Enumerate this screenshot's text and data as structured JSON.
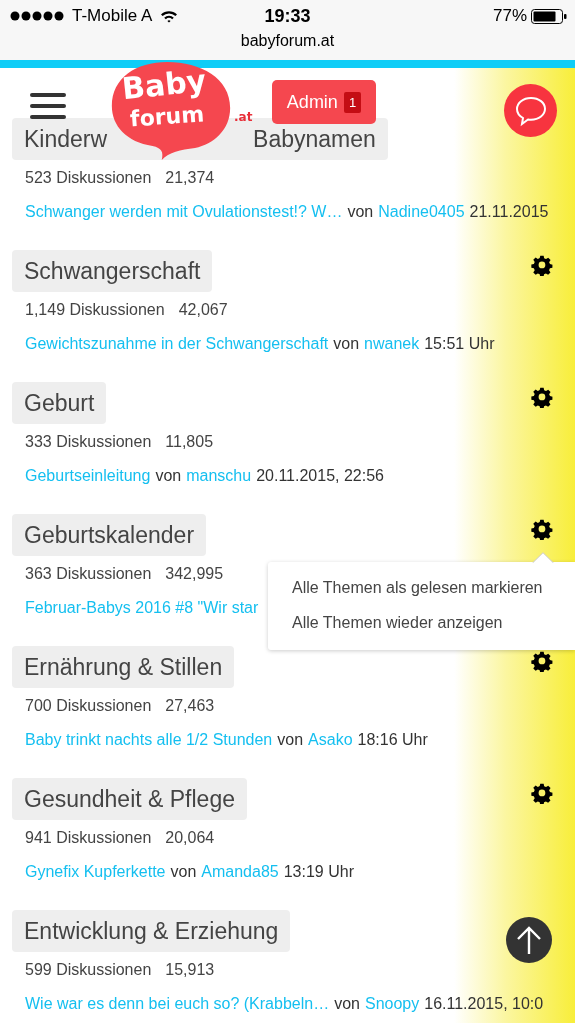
{
  "status_bar": {
    "carrier": "T-Mobile A",
    "time": "19:33",
    "battery": "77%"
  },
  "address_bar": {
    "url": "babyforum.at"
  },
  "header": {
    "logo": {
      "line1": "Baby",
      "line2": "forum",
      "suffix": ".at"
    },
    "admin_button": {
      "label": "Admin",
      "badge": "1"
    }
  },
  "categories": [
    {
      "title_fragments": [
        "Kinderw",
        "Babynamen"
      ],
      "gear_hidden": true,
      "discussions": "523 Diskussionen",
      "count": "21,374",
      "last_post": {
        "topic": "Schwanger werden mit Ovulationstest!? W…",
        "by": "von",
        "author": "Nadine0405",
        "time": "21.11.2015"
      }
    },
    {
      "title": "Schwangerschaft",
      "discussions": "1,149 Diskussionen",
      "count": "42,067",
      "last_post": {
        "topic": "Gewichtszunahme in der Schwangerschaft",
        "by": "von",
        "author": "nwanek",
        "time": "15:51 Uhr"
      }
    },
    {
      "title": "Geburt",
      "discussions": "333 Diskussionen",
      "count": "11,805",
      "last_post": {
        "topic": "Geburtseinleitung",
        "by": "von",
        "author": "manschu",
        "time": "20.11.2015, 22:56"
      }
    },
    {
      "title": "Geburtskalender",
      "discussions": "363 Diskussionen",
      "count": "342,995",
      "last_post": {
        "topic": "Februar-Babys 2016 #8 \"Wir star"
      },
      "menu": {
        "items": [
          "Alle Themen als gelesen markieren",
          "Alle Themen wieder anzeigen"
        ]
      }
    },
    {
      "title": "Ernährung & Stillen",
      "discussions": "700 Diskussionen",
      "count": "27,463",
      "last_post": {
        "topic": "Baby trinkt nachts alle 1/2 Stunden",
        "by": "von",
        "author": "Asako",
        "time": "18:16 Uhr"
      }
    },
    {
      "title": "Gesundheit & Pflege",
      "discussions": "941 Diskussionen",
      "count": "20,064",
      "last_post": {
        "topic": "Gynefix Kupferkette",
        "by": "von",
        "author": "Amanda85",
        "time": "13:19 Uhr"
      }
    },
    {
      "title": "Entwicklung & Erziehung",
      "gear_hidden": true,
      "discussions": "599 Diskussionen",
      "count": "15,913",
      "last_post": {
        "topic": "Wie war es denn bei euch so? (Krabbeln…",
        "by": "von",
        "author": "Snoopy",
        "time": "16.11.2015, 10:0"
      }
    }
  ]
}
